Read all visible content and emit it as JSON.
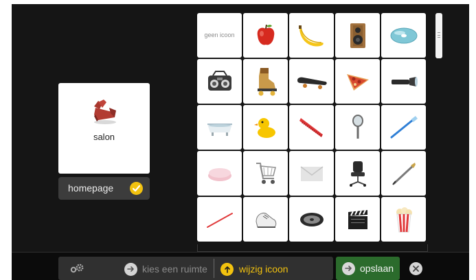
{
  "room": {
    "label": "salon",
    "icon": "armchair-icon",
    "homepage_label": "homepage",
    "homepage_checked": true
  },
  "grid": {
    "no_icon_label": "geen icoon",
    "tiles": [
      "no-icon",
      "apple-icon",
      "banana-icon",
      "speaker-icon",
      "cd-disc-icon",
      "boombox-icon",
      "roller-skate-icon",
      "skateboard-icon",
      "pizza-slice-icon",
      "flashlight-icon",
      "bathtub-icon",
      "rubber-duck-icon",
      "comb-icon",
      "mirror-icon",
      "toothbrush-icon",
      "soap-bar-icon",
      "shopping-cart-icon",
      "envelope-icon",
      "office-chair-icon",
      "fountain-pen-icon",
      "pencil-icon",
      "sneaker-icon",
      "film-reel-icon",
      "clapperboard-icon",
      "popcorn-icon"
    ]
  },
  "toolbar": {
    "settings_icon": "gear-icon",
    "step_room_label": "kies een ruimte",
    "step_icon_label": "wijzig icoon",
    "save_label": "opslaan",
    "close_icon": "close-icon"
  },
  "colors": {
    "accent_yellow": "#f2c20f",
    "save_green": "#2b6b2c",
    "background": "#151515"
  }
}
